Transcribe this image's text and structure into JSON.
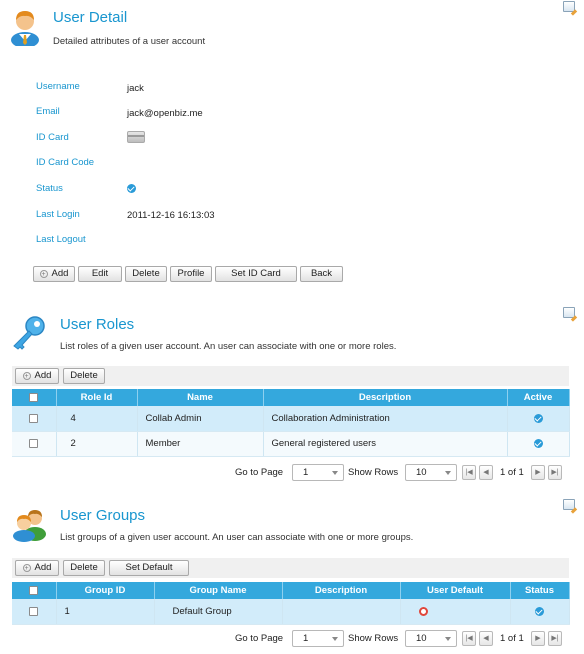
{
  "user_detail": {
    "title": "User Detail",
    "description": "Detailed attributes of a user account",
    "fields": [
      {
        "label": "Username",
        "value": "jack"
      },
      {
        "label": "Email",
        "value": "jack@openbiz.me"
      },
      {
        "label": "ID Card",
        "value": ""
      },
      {
        "label": "ID Card Code",
        "value": ""
      },
      {
        "label": "Status",
        "value": ""
      },
      {
        "label": "Last Login",
        "value": "2011-12-16 16:13:03"
      },
      {
        "label": "Last Logout",
        "value": ""
      }
    ],
    "buttons": {
      "add": "Add",
      "edit": "Edit",
      "delete": "Delete",
      "profile": "Profile",
      "set_id_card": "Set ID Card",
      "back": "Back"
    }
  },
  "user_roles": {
    "title": "User Roles",
    "description": "List roles of a given user account. An user can associate with one or more roles.",
    "buttons": {
      "add": "Add",
      "delete": "Delete"
    },
    "columns": [
      "Role Id",
      "Name",
      "Description",
      "Active"
    ],
    "rows": [
      {
        "id": "4",
        "name": "Collab Admin",
        "description": "Collaboration Administration",
        "active": true
      },
      {
        "id": "2",
        "name": "Member",
        "description": "General registered users",
        "active": true
      }
    ],
    "pager": {
      "go_to_page": "Go to Page",
      "page": "1",
      "show_rows": "Show Rows",
      "rows": "10",
      "page_info": "1 of 1"
    }
  },
  "user_groups": {
    "title": "User Groups",
    "description": "List groups of a given user account. An user can associate with one or more groups.",
    "buttons": {
      "add": "Add",
      "delete": "Delete",
      "set_default": "Set Default"
    },
    "columns": [
      "Group ID",
      "Group Name",
      "Description",
      "User Default",
      "Status"
    ],
    "rows": [
      {
        "id": "1",
        "name": "Default Group",
        "description": "",
        "user_default": true,
        "status": true
      }
    ],
    "pager": {
      "go_to_page": "Go to Page",
      "page": "1",
      "show_rows": "Show Rows",
      "rows": "10",
      "page_info": "1 of 1"
    }
  },
  "colors": {
    "accent": "#1996cf",
    "header": "#34a8dd",
    "selected_row": "#d2ecfa"
  }
}
